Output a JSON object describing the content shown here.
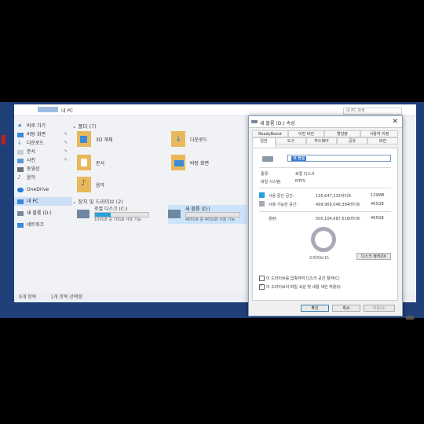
{
  "explorer": {
    "title": "내 PC",
    "search_placeholder": "내 PC 검색",
    "sidebar": [
      {
        "label": "바로 가기"
      },
      {
        "label": "바탕 화면",
        "pinned": true
      },
      {
        "label": "다운로드",
        "pinned": true
      },
      {
        "label": "문서",
        "pinned": true
      },
      {
        "label": "사진",
        "pinned": true
      },
      {
        "label": "동영상"
      },
      {
        "label": "음악"
      },
      {
        "label": "OneDrive"
      },
      {
        "label": "내 PC"
      },
      {
        "label": "새 볼륨 (D:)"
      },
      {
        "label": "네트워크"
      }
    ],
    "folders_header": "폴더 (7)",
    "folders": [
      {
        "label": "3D 개체"
      },
      {
        "label": "다운로드"
      },
      {
        "label": "문서"
      },
      {
        "label": "바탕 화면"
      },
      {
        "label": "음악"
      }
    ],
    "devices_header": "장치 및 드라이브 (2)",
    "drives": [
      {
        "name": "로컬 디스크 (C:)",
        "free": "100GB 중 70GB 사용 가능",
        "used_fraction": 0.3
      },
      {
        "name": "새 볼륨 (D:)",
        "free": "465GB 중 465GB 사용 가능",
        "used_fraction": 0.0
      }
    ],
    "status": {
      "items": "9개 항목",
      "selected": "1개 항목 선택함"
    }
  },
  "dialog": {
    "title": "새 볼륨 (D:) 속성",
    "tabs_row1": [
      "ReadyBoost",
      "이전 버전",
      "할당량",
      "사용자 지정"
    ],
    "tabs_row2": [
      "일반",
      "도구",
      "하드웨어",
      "공유",
      "보안"
    ],
    "name_value": "새 볼륨",
    "type_label": "종류:",
    "type_value": "로컬 디스크",
    "fs_label": "파일 시스템:",
    "fs_value": "NTFS",
    "used_label": "사용 중인 공간:",
    "used_bytes": "135,647,232바이트",
    "used_size": "129MB",
    "free_label": "사용 가능한 공간:",
    "free_bytes": "499,969,048,384바이트",
    "free_size": "465GB",
    "capacity_label": "용량:",
    "capacity_bytes": "500,104,687,616바이트",
    "capacity_size": "465GB",
    "drive_label": "드라이브 D:",
    "cleanup_button": "디스크 정리(D)",
    "compress_label": "이 드라이브를 압축하여 디스크 공간 절약(C)",
    "index_label": "이 드라이브의 파일 속성 및 내용 색인 허용(I)",
    "ok": "확인",
    "cancel": "취소",
    "apply": "적용(A)",
    "used_fraction": 0.0003,
    "colors": {
      "used": "#26a0da",
      "free": "#a9a9b8"
    }
  }
}
